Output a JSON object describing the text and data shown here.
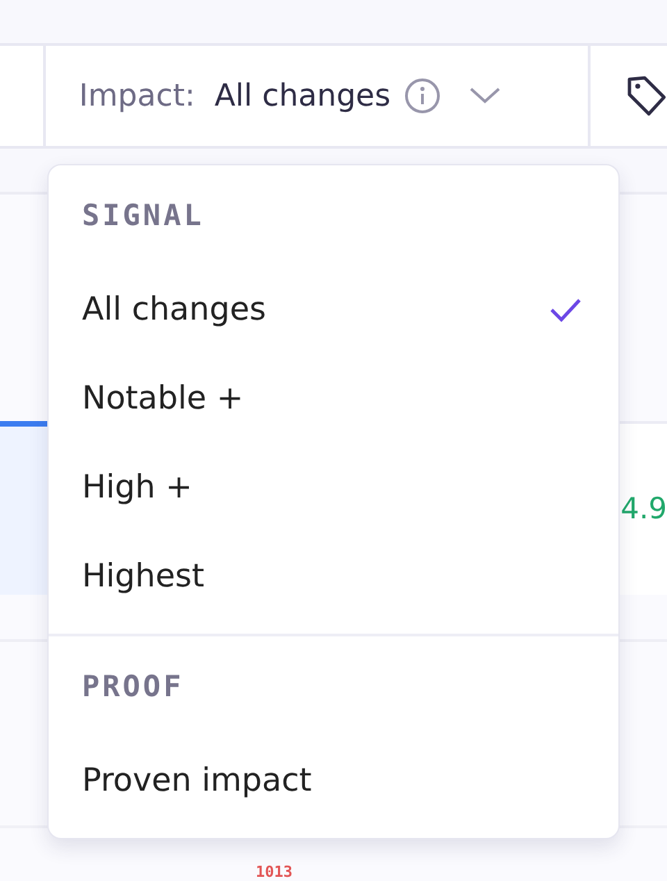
{
  "filter": {
    "label": "Impact:",
    "value": "All changes"
  },
  "dropdown": {
    "sections": [
      {
        "heading": "SIGNAL",
        "options": [
          {
            "label": "All changes",
            "selected": true
          },
          {
            "label": "Notable +",
            "selected": false
          },
          {
            "label": "High +",
            "selected": false
          },
          {
            "label": "Highest",
            "selected": false
          }
        ]
      },
      {
        "heading": "PROOF",
        "options": [
          {
            "label": "Proven impact",
            "selected": false
          }
        ]
      }
    ]
  },
  "background": {
    "card_value": "4.9",
    "footer_number": "1013"
  }
}
